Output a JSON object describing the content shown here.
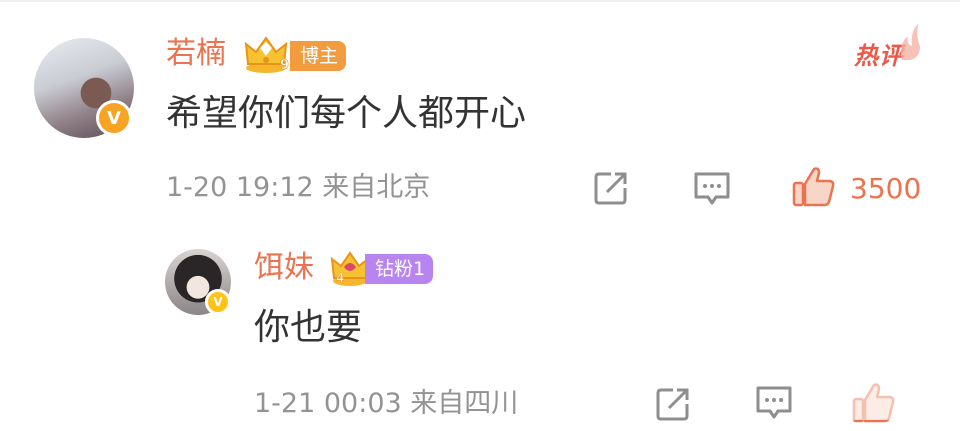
{
  "hot_tag": "热评",
  "comment": {
    "username": "若楠",
    "level_badge": "博主",
    "crown_number": "9",
    "content": "希望你们每个人都开心",
    "meta": "1-20 19:12 来自北京",
    "like_count": "3500",
    "icons": [
      "avatar",
      "verified-v-icon",
      "crown-icon",
      "share-icon",
      "comment-icon",
      "like-icon"
    ]
  },
  "reply": {
    "username": "饵妹",
    "level_badge": "钻粉1",
    "crown_number": "4",
    "content": "你也要",
    "meta": "1-21 00:03 来自四川",
    "icons": [
      "avatar",
      "verified-v-icon",
      "crown-icon",
      "share-icon",
      "comment-icon",
      "like-icon"
    ]
  },
  "colors": {
    "username": "#eb7350",
    "content": "#333333",
    "meta": "#939393",
    "hot_tag": "#eb5a49",
    "blogger_badge": "#f39c3d",
    "fan_badge": "#b784f0",
    "verified": "#ffc21a"
  }
}
